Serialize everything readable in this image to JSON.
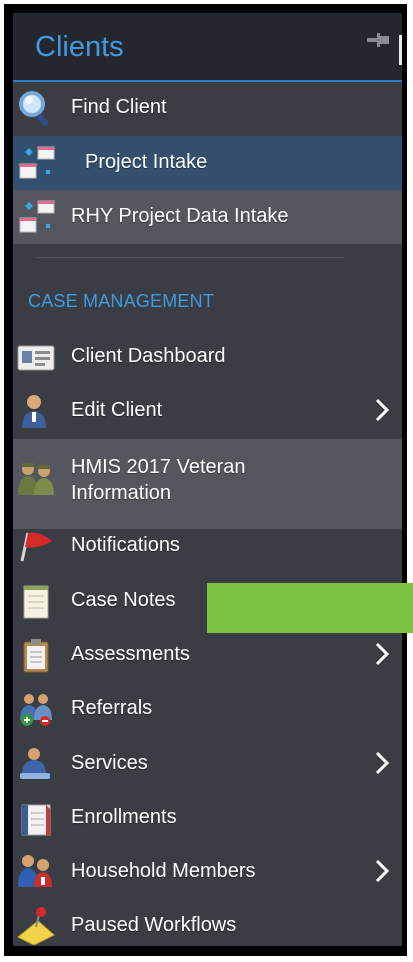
{
  "panel": {
    "title": "Clients",
    "pin_icon": "pin-icon"
  },
  "top_items": [
    {
      "label": "Find Client",
      "icon": "magnifier-icon"
    },
    {
      "label": "Project Intake",
      "icon": "intake-forms-icon",
      "highlight": "selected"
    },
    {
      "label": "RHY Project Data Intake",
      "icon": "intake-forms-icon",
      "highlight": "hover"
    }
  ],
  "section": {
    "title": "CASE MANAGEMENT"
  },
  "case_items": [
    {
      "label": "Client Dashboard",
      "icon": "id-card-icon"
    },
    {
      "label": "Edit Client",
      "icon": "person-icon",
      "has_submenu": true
    },
    {
      "label_line1": "HMIS 2017 Veteran",
      "label_line2": "Information",
      "icon": "soldiers-icon",
      "highlight": "hover"
    },
    {
      "label": "Notifications",
      "icon": "red-flag-icon"
    },
    {
      "label": "Case Notes",
      "icon": "notepad-icon"
    },
    {
      "label": "Assessments",
      "icon": "clipboard-icon",
      "has_submenu": true
    },
    {
      "label": "Referrals",
      "icon": "referral-people-icon"
    },
    {
      "label": "Services",
      "icon": "service-person-icon",
      "has_submenu": true
    },
    {
      "label": "Enrollments",
      "icon": "calendar-icon"
    },
    {
      "label": "Household Members",
      "icon": "household-icon",
      "has_submenu": true
    },
    {
      "label": "Paused Workflows",
      "icon": "pushpin-note-icon"
    }
  ],
  "colors": {
    "panel_bg": "#3b3d45",
    "header_bg": "#25272e",
    "accent_blue": "#3f9ae0",
    "selected_bg": "#33506f",
    "hover_bg": "#55575f",
    "annotation_green": "#7cc242"
  }
}
